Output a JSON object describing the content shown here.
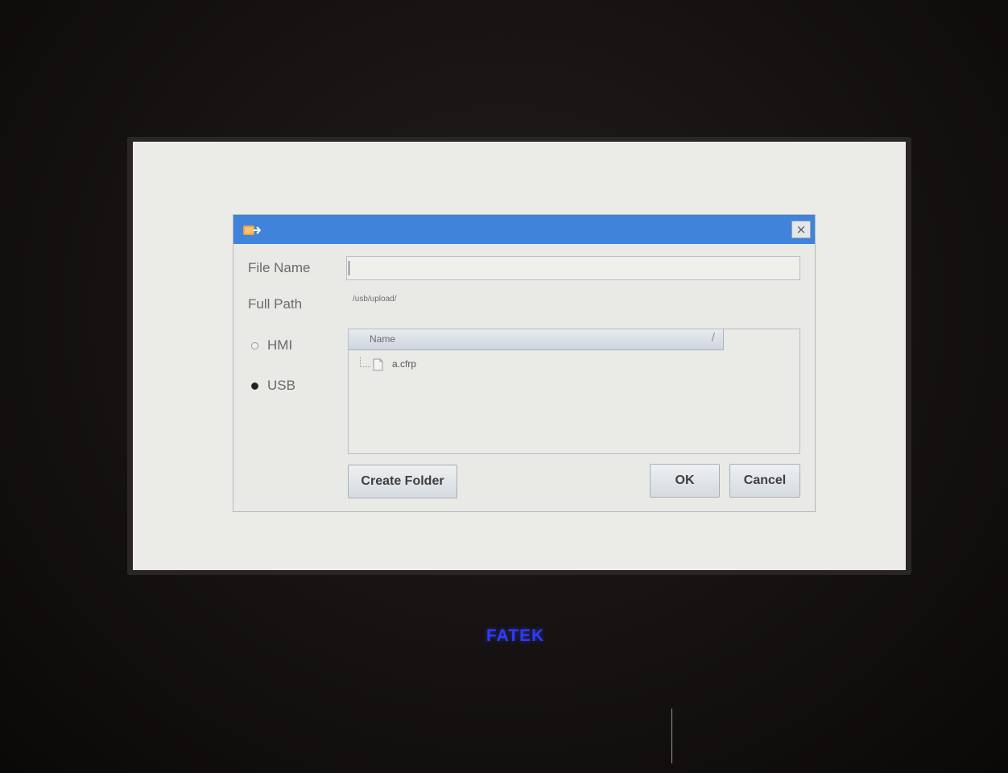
{
  "dialog": {
    "close_label": "×",
    "labels": {
      "file_name": "File Name",
      "full_path": "Full Path"
    },
    "file_name_value": "",
    "full_path_value": "/usb/upload/",
    "storage": {
      "options": [
        {
          "label": "HMI",
          "selected": false
        },
        {
          "label": "USB",
          "selected": true
        }
      ]
    },
    "file_list": {
      "column_header": "Name",
      "sort_indicator": "/",
      "items": [
        {
          "name": "a.cfrp",
          "icon": "file-icon"
        }
      ]
    },
    "buttons": {
      "create_folder": "Create Folder",
      "ok": "OK",
      "cancel": "Cancel"
    }
  },
  "device": {
    "brand": "FATEK"
  },
  "colors": {
    "titlebar": "#3f83da",
    "brand": "#2d3cff",
    "screen_background": "#ebebe8"
  },
  "icons": {
    "title_icon": "dialog-app-icon",
    "close": "close-icon",
    "file": "file-icon"
  }
}
